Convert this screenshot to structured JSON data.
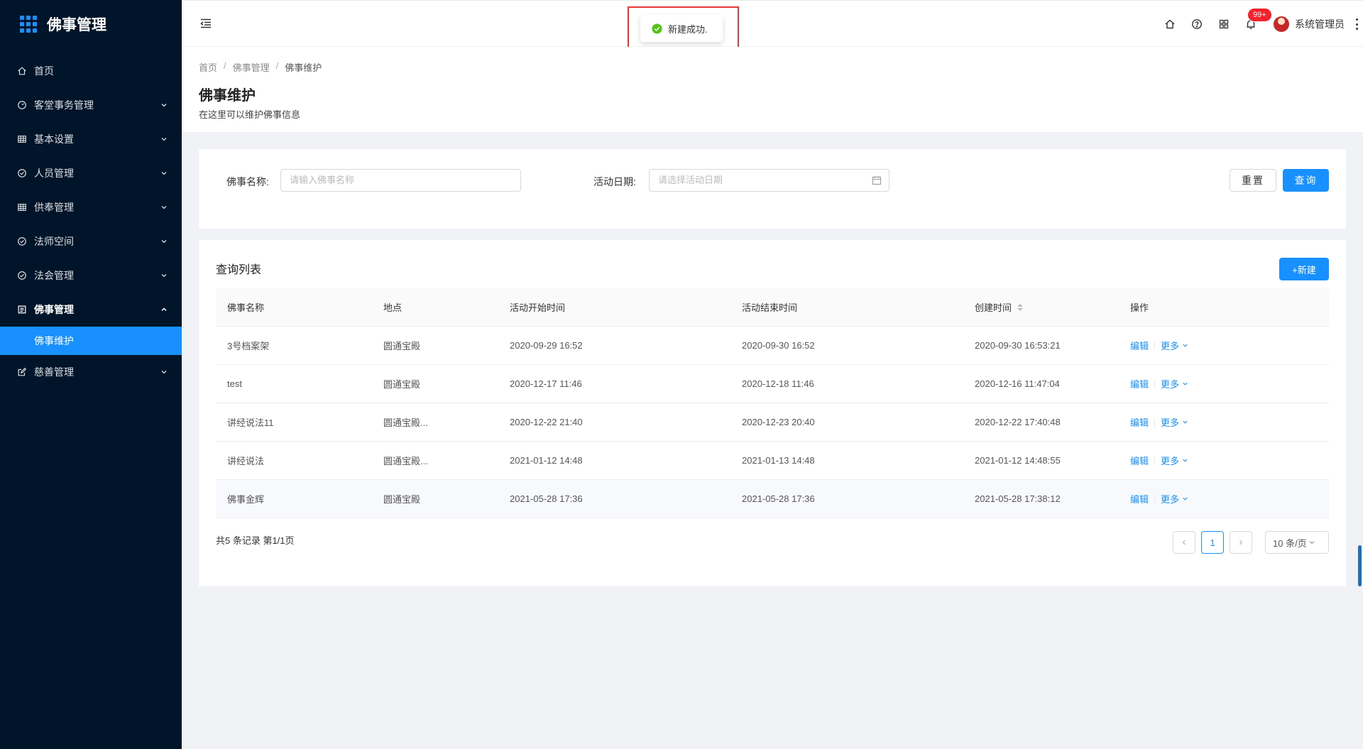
{
  "app": {
    "title": "佛事管理"
  },
  "sidebar": {
    "items": [
      {
        "label": "首页",
        "icon": "home-icon",
        "has_arrow": false
      },
      {
        "label": "客堂事务管理",
        "icon": "dashboard-icon",
        "has_arrow": true
      },
      {
        "label": "基本设置",
        "icon": "table-icon",
        "has_arrow": true
      },
      {
        "label": "人员管理",
        "icon": "check-circle-icon",
        "has_arrow": true
      },
      {
        "label": "供奉管理",
        "icon": "table-icon",
        "has_arrow": true
      },
      {
        "label": "法师空间",
        "icon": "check-circle-icon",
        "has_arrow": true
      },
      {
        "label": "法会管理",
        "icon": "check-circle-icon",
        "has_arrow": true
      },
      {
        "label": "佛事管理",
        "icon": "profile-icon",
        "has_arrow": true,
        "open": true
      },
      {
        "label": "慈善管理",
        "icon": "form-icon",
        "has_arrow": true
      }
    ],
    "submenu_active": "佛事维护"
  },
  "header": {
    "notification_count": "99+",
    "user_name": "系统管理员"
  },
  "toast": {
    "message": "新建成功."
  },
  "breadcrumb": [
    "首页",
    "佛事管理",
    "佛事维护"
  ],
  "page": {
    "title": "佛事维护",
    "description": "在这里可以维护佛事信息"
  },
  "search": {
    "name_label": "佛事名称:",
    "name_placeholder": "请输入佛事名称",
    "date_label": "活动日期:",
    "date_placeholder": "请选择活动日期",
    "reset_label": "重置",
    "query_label": "查询"
  },
  "list": {
    "title": "查询列表",
    "new_label": "+新建",
    "columns": [
      "佛事名称",
      "地点",
      "活动开始时间",
      "活动结束时间",
      "创建时间",
      "操作"
    ],
    "rows": [
      {
        "name": "3号档案架",
        "place": "圆通宝殿",
        "start": "2020-09-29 16:52",
        "end": "2020-09-30 16:52",
        "created": "2020-09-30 16:53:21"
      },
      {
        "name": "test",
        "place": "圆通宝殿",
        "start": "2020-12-17 11:46",
        "end": "2020-12-18 11:46",
        "created": "2020-12-16 11:47:04"
      },
      {
        "name": "讲经说法11",
        "place": "圆通宝殿...",
        "start": "2020-12-22 21:40",
        "end": "2020-12-23 20:40",
        "created": "2020-12-22 17:40:48"
      },
      {
        "name": "讲经说法",
        "place": "圆通宝殿...",
        "start": "2021-01-12 14:48",
        "end": "2021-01-13 14:48",
        "created": "2021-01-12 14:48:55"
      },
      {
        "name": "佛事金辉",
        "place": "圆通宝殿",
        "start": "2021-05-28 17:36",
        "end": "2021-05-28 17:36",
        "created": "2021-05-28 17:38:12"
      }
    ],
    "edit_label": "编辑",
    "more_label": "更多"
  },
  "pagination": {
    "summary": "共5 条记录 第1/1页",
    "current_page": "1",
    "page_size": "10 条/页"
  },
  "colors": {
    "primary": "#1890ff",
    "sidebar_bg": "#001529",
    "success": "#52c41a",
    "badge": "#f5222d"
  }
}
